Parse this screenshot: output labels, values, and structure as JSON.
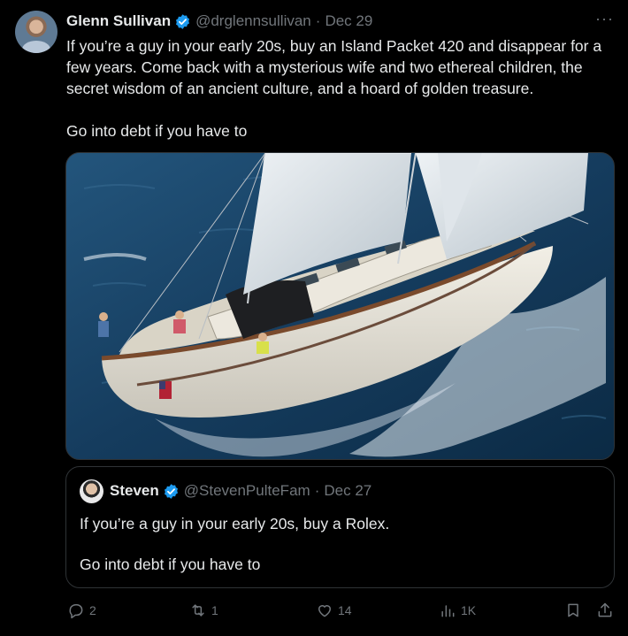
{
  "tweet": {
    "author_name": "Glenn Sullivan",
    "handle": "@drglennsullivan",
    "separator": "·",
    "date": "Dec 29",
    "more_icon": "more-icon",
    "text": "If you’re a guy in your early 20s, buy an Island Packet 420 and disappear for a few years. Come back with a mysterious wife and two ethereal children, the secret wisdom of an ancient culture, and a hoard of golden treasure.\n\nGo into debt if you have to"
  },
  "quote": {
    "author_name": "Steven",
    "handle": "@StevenPulteFam",
    "separator": "·",
    "date": "Dec 27",
    "line1": "If you’re a guy in your early 20s, buy a Rolex.",
    "line2": "Go into debt if you have to"
  },
  "actions": {
    "replies": "2",
    "retweets": "1",
    "likes": "14",
    "views": "1K"
  },
  "colors": {
    "background": "#000000",
    "text": "#e7e9ea",
    "muted": "#71767b",
    "verified": "#1d9bf0",
    "border": "#2f3336"
  }
}
